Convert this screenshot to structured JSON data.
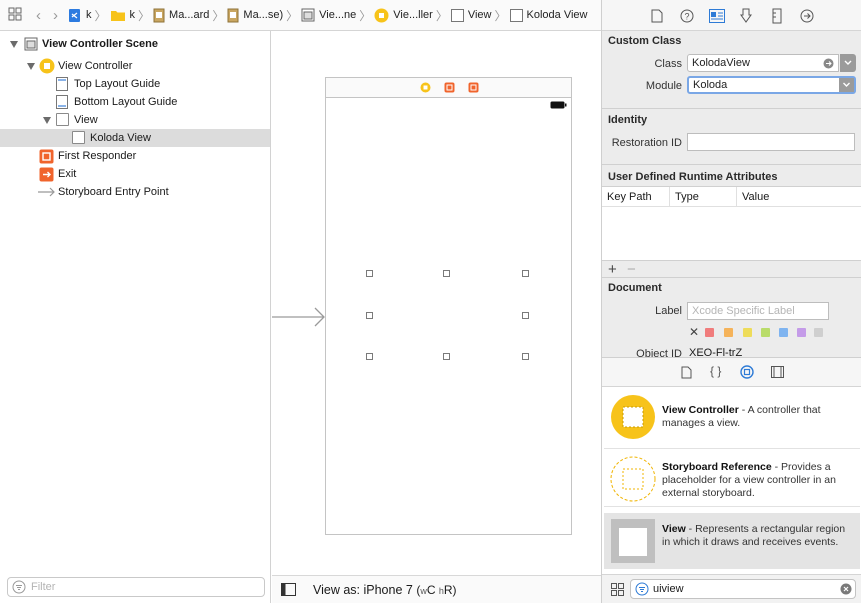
{
  "jumpbar": {
    "items": [
      {
        "label": "k",
        "icon": "swift-file-icon"
      },
      {
        "label": "k",
        "icon": "folder-icon"
      },
      {
        "label": "Ma...ard",
        "icon": "storyboard-file-icon"
      },
      {
        "label": "Ma...se)",
        "icon": "storyboard-file-icon"
      },
      {
        "label": "Vie...ne",
        "icon": "scene-icon"
      },
      {
        "label": "Vie...ller",
        "icon": "view-controller-icon"
      },
      {
        "label": "View",
        "icon": "view-icon"
      },
      {
        "label": "Koloda View",
        "icon": "view-icon"
      }
    ]
  },
  "outline": {
    "scene": "View Controller Scene",
    "view_controller": "View Controller",
    "top_layout_guide": "Top Layout Guide",
    "bottom_layout_guide": "Bottom Layout Guide",
    "view": "View",
    "koloda_view": "Koloda View",
    "first_responder": "First Responder",
    "exit": "Exit",
    "entry_point": "Storyboard Entry Point",
    "filter_placeholder": "Filter"
  },
  "canvas": {
    "view_as_label": "View as: iPhone 7",
    "size_class_w": "w",
    "size_class_w_value": "C",
    "size_class_h": "h",
    "size_class_h_value": "R"
  },
  "inspector": {
    "custom_class": {
      "title": "Custom Class",
      "class_label": "Class",
      "class_value": "KolodaView",
      "module_label": "Module",
      "module_value": "Koloda"
    },
    "identity": {
      "title": "Identity",
      "restoration_label": "Restoration ID",
      "restoration_value": ""
    },
    "runtime_attrs": {
      "title": "User Defined Runtime Attributes",
      "columns": [
        "Key Path",
        "Type",
        "Value"
      ]
    },
    "document": {
      "title": "Document",
      "label_label": "Label",
      "label_placeholder": "Xcode Specific Label",
      "object_id_label": "Object ID",
      "object_id_value": "XEO-Fl-trZ"
    },
    "color_labels": [
      "#f07c7c",
      "#f5b35a",
      "#eedc5a",
      "#b9dc6a",
      "#7fb4f0",
      "#c49be8",
      "#cfcfcf"
    ]
  },
  "library": {
    "items": [
      {
        "title": "View Controller",
        "desc": " - A controller that manages a view."
      },
      {
        "title": "Storyboard Reference",
        "desc": " - Provides a placeholder for a view controller in an external storyboard."
      },
      {
        "title": "View",
        "desc": " - Represents a rectangular region in which it draws and receives events."
      }
    ],
    "search_value": "uiview"
  },
  "colors": {
    "accent": "#2e7bd6",
    "vc_yellow": "#f7c31a",
    "orange": "#f0642c"
  }
}
